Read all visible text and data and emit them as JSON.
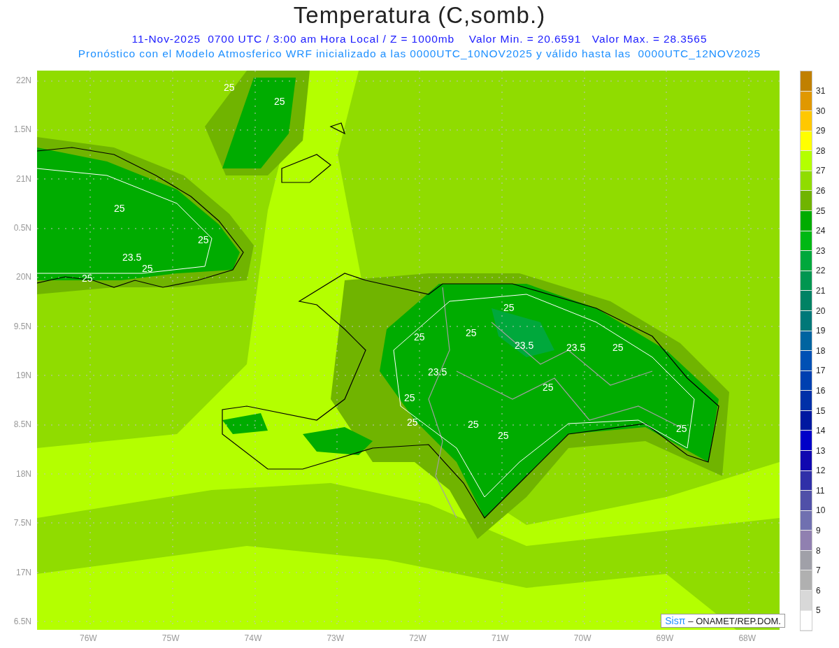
{
  "title": "Temperatura (C,somb.)",
  "subtitle_lines": [
    "11-Nov-2025  0700 UTC / 3:00 am Hora Local / Z = 1000mb    Valor Min. = 20.6591   Valor Max. = 28.3565",
    "Pronóstico con el Modelo Atmosferico WRF inicializado a las 0000UTC_10NOV2025 y válido hasta las  0000UTC_12NOV2025"
  ],
  "map": {
    "contour_labels": [
      "25",
      "25",
      "25",
      "25",
      "23.5",
      "25",
      "25",
      "25",
      "25",
      "25",
      "23.5",
      "23.5",
      "25",
      "23.5",
      "25",
      "25",
      "25",
      "25",
      "25",
      "25"
    ],
    "credit": {
      "logo": "Sisπ",
      "text": "– ONAMET/REP.DOM."
    }
  },
  "y_axis_labels": [
    "22N",
    "1.5N",
    "21N",
    "0.5N",
    "20N",
    "9.5N",
    "19N",
    "8.5N",
    "18N",
    "7.5N",
    "17N",
    "6.5N"
  ],
  "x_axis_labels": [
    "76W",
    "75W",
    "74W",
    "73W",
    "72W",
    "71W",
    "70W",
    "69W",
    "68W"
  ],
  "colorbar": {
    "swatches": [
      {
        "color": "#c08000"
      },
      {
        "color": "#e09800"
      },
      {
        "color": "#ffc800"
      },
      {
        "color": "#ffff00"
      },
      {
        "color": "#b4ff00"
      },
      {
        "color": "#90dc00"
      },
      {
        "color": "#70b400"
      },
      {
        "color": "#00ac00"
      },
      {
        "color": "#00b814"
      },
      {
        "color": "#00a83c"
      },
      {
        "color": "#009650"
      },
      {
        "color": "#008264"
      },
      {
        "color": "#007878"
      },
      {
        "color": "#0064a0"
      },
      {
        "color": "#0050b4"
      },
      {
        "color": "#0040b0"
      },
      {
        "color": "#0030a8"
      },
      {
        "color": "#0018a0"
      },
      {
        "color": "#0000c8"
      },
      {
        "color": "#1008b0"
      },
      {
        "color": "#3030a8"
      },
      {
        "color": "#5050a8"
      },
      {
        "color": "#7070b0"
      },
      {
        "color": "#9080b0"
      },
      {
        "color": "#a0a0a8"
      },
      {
        "color": "#b0b0b0"
      },
      {
        "color": "#d8d8d8"
      },
      {
        "color": "#ffffff"
      }
    ],
    "labels": [
      "31",
      "30",
      "29",
      "28",
      "27",
      "26",
      "25",
      "24",
      "23",
      "22",
      "21",
      "20",
      "19",
      "18",
      "17",
      "16",
      "15",
      "14",
      "13",
      "12",
      "11",
      "10",
      "9",
      "8",
      "7",
      "6",
      "5"
    ]
  }
}
